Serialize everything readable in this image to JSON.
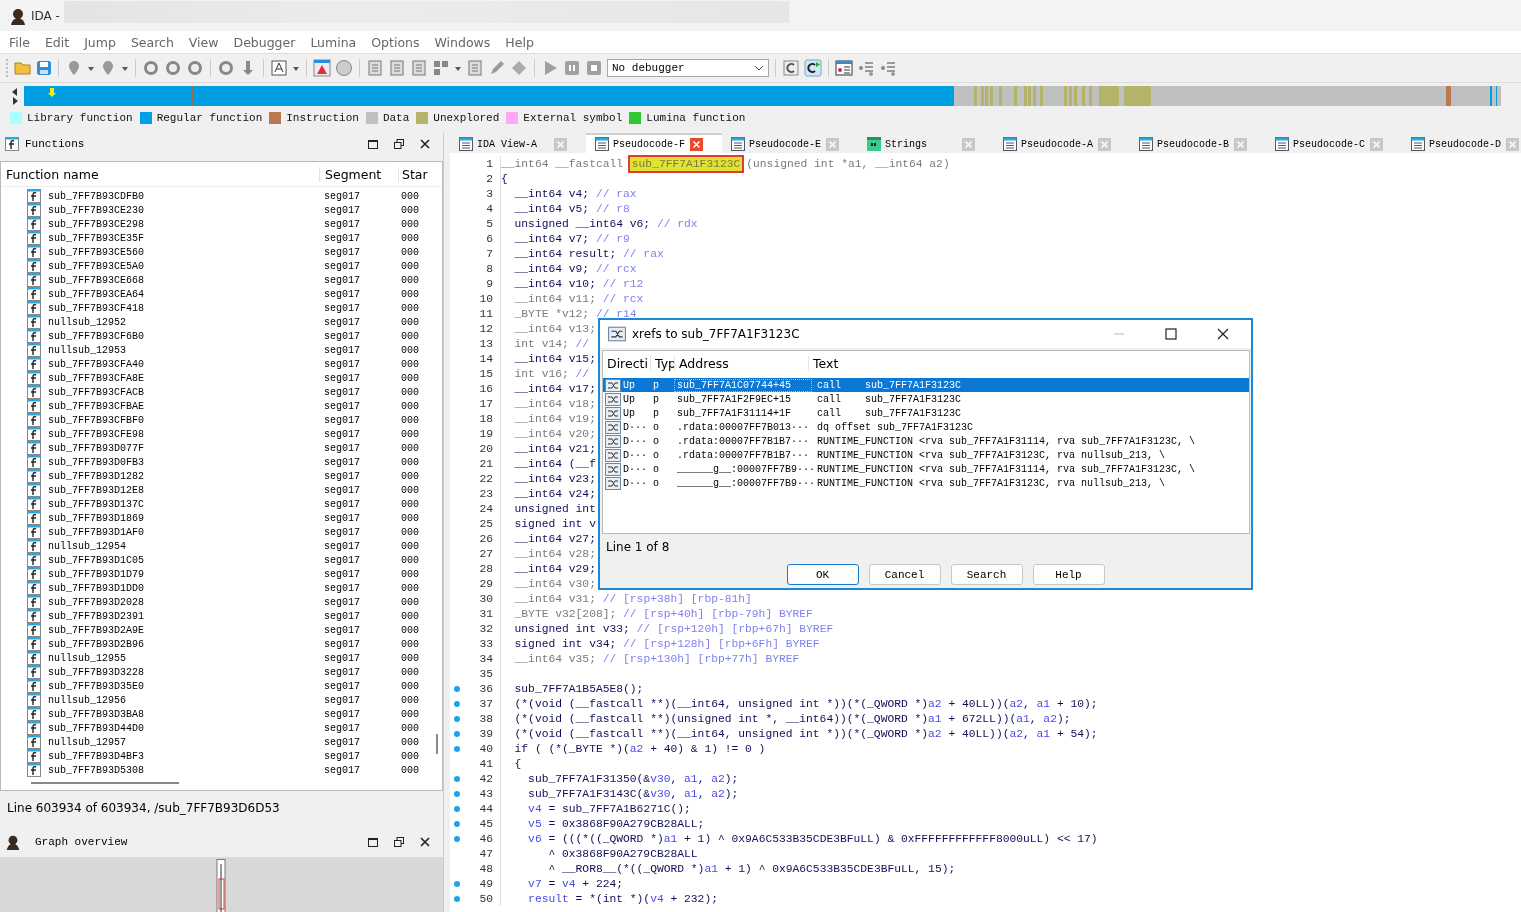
{
  "window": {
    "title": "IDA -"
  },
  "menu": [
    "File",
    "Edit",
    "Jump",
    "Search",
    "View",
    "Debugger",
    "Lumina",
    "Options",
    "Windows",
    "Help"
  ],
  "toolbar": {
    "debugger": "No debugger"
  },
  "legend": [
    {
      "label": "Library function",
      "color": "#aaffff"
    },
    {
      "label": "Regular function",
      "color": "#00a0e8"
    },
    {
      "label": "Instruction",
      "color": "#b87850"
    },
    {
      "label": "Data",
      "color": "#c0c0c0"
    },
    {
      "label": "Unexplored",
      "color": "#b4b468"
    },
    {
      "label": "External symbol",
      "color": "#ffa8f8"
    },
    {
      "label": "Lumina function",
      "color": "#30c830"
    }
  ],
  "functions_pane": {
    "title": "Functions",
    "columns": [
      "Function name",
      "Segment",
      "Star"
    ],
    "rows": [
      {
        "name": "sub_7FF7B93CDFB0",
        "segment": "seg017",
        "start": "000"
      },
      {
        "name": "sub_7FF7B93CE230",
        "segment": "seg017",
        "start": "000"
      },
      {
        "name": "sub_7FF7B93CE298",
        "segment": "seg017",
        "start": "000"
      },
      {
        "name": "sub_7FF7B93CE35F",
        "segment": "seg017",
        "start": "000"
      },
      {
        "name": "sub_7FF7B93CE560",
        "segment": "seg017",
        "start": "000"
      },
      {
        "name": "sub_7FF7B93CE5A0",
        "segment": "seg017",
        "start": "000"
      },
      {
        "name": "sub_7FF7B93CE668",
        "segment": "seg017",
        "start": "000"
      },
      {
        "name": "sub_7FF7B93CEA64",
        "segment": "seg017",
        "start": "000"
      },
      {
        "name": "sub_7FF7B93CF418",
        "segment": "seg017",
        "start": "000"
      },
      {
        "name": "nullsub_12952",
        "segment": "seg017",
        "start": "000"
      },
      {
        "name": "sub_7FF7B93CF6B0",
        "segment": "seg017",
        "start": "000"
      },
      {
        "name": "nullsub_12953",
        "segment": "seg017",
        "start": "000"
      },
      {
        "name": "sub_7FF7B93CFA40",
        "segment": "seg017",
        "start": "000"
      },
      {
        "name": "sub_7FF7B93CFA8E",
        "segment": "seg017",
        "start": "000"
      },
      {
        "name": "sub_7FF7B93CFACB",
        "segment": "seg017",
        "start": "000"
      },
      {
        "name": "sub_7FF7B93CFBAE",
        "segment": "seg017",
        "start": "000"
      },
      {
        "name": "sub_7FF7B93CFBF0",
        "segment": "seg017",
        "start": "000"
      },
      {
        "name": "sub_7FF7B93CFE98",
        "segment": "seg017",
        "start": "000"
      },
      {
        "name": "sub_7FF7B93D077F",
        "segment": "seg017",
        "start": "000"
      },
      {
        "name": "sub_7FF7B93D0FB3",
        "segment": "seg017",
        "start": "000"
      },
      {
        "name": "sub_7FF7B93D1282",
        "segment": "seg017",
        "start": "000"
      },
      {
        "name": "sub_7FF7B93D12E8",
        "segment": "seg017",
        "start": "000"
      },
      {
        "name": "sub_7FF7B93D137C",
        "segment": "seg017",
        "start": "000"
      },
      {
        "name": "sub_7FF7B93D1869",
        "segment": "seg017",
        "start": "000"
      },
      {
        "name": "sub_7FF7B93D1AF0",
        "segment": "seg017",
        "start": "000"
      },
      {
        "name": "nullsub_12954",
        "segment": "seg017",
        "start": "000"
      },
      {
        "name": "sub_7FF7B93D1C05",
        "segment": "seg017",
        "start": "000"
      },
      {
        "name": "sub_7FF7B93D1D79",
        "segment": "seg017",
        "start": "000"
      },
      {
        "name": "sub_7FF7B93D1DD0",
        "segment": "seg017",
        "start": "000"
      },
      {
        "name": "sub_7FF7B93D2028",
        "segment": "seg017",
        "start": "000"
      },
      {
        "name": "sub_7FF7B93D2391",
        "segment": "seg017",
        "start": "000"
      },
      {
        "name": "sub_7FF7B93D2A9E",
        "segment": "seg017",
        "start": "000"
      },
      {
        "name": "sub_7FF7B93D2B96",
        "segment": "seg017",
        "start": "000"
      },
      {
        "name": "nullsub_12955",
        "segment": "seg017",
        "start": "000"
      },
      {
        "name": "sub_7FF7B93D3228",
        "segment": "seg017",
        "start": "000"
      },
      {
        "name": "sub_7FF7B93D35E0",
        "segment": "seg017",
        "start": "000"
      },
      {
        "name": "nullsub_12956",
        "segment": "seg017",
        "start": "000"
      },
      {
        "name": "sub_7FF7B93D3BA8",
        "segment": "seg017",
        "start": "000"
      },
      {
        "name": "sub_7FF7B93D44D0",
        "segment": "seg017",
        "start": "000"
      },
      {
        "name": "nullsub_12957",
        "segment": "seg017",
        "start": "000"
      },
      {
        "name": "sub_7FF7B93D4BF3",
        "segment": "seg017",
        "start": "000"
      },
      {
        "name": "sub_7FF7B93D5308",
        "segment": "seg017",
        "start": "000"
      }
    ],
    "status": "Line 603934 of 603934, /sub_7FF7B93D6D53"
  },
  "graph_overview": {
    "title": "Graph overview"
  },
  "tabs": [
    {
      "label": "IDA View-A",
      "kind": "view",
      "selected": false
    },
    {
      "label": "Pseudocode-F",
      "kind": "view",
      "selected": true
    },
    {
      "label": "Pseudocode-E",
      "kind": "view",
      "selected": false
    },
    {
      "label": "Strings",
      "kind": "strings",
      "selected": false
    },
    {
      "label": "Pseudocode-A",
      "kind": "view",
      "selected": false
    },
    {
      "label": "Pseudocode-B",
      "kind": "view",
      "selected": false
    },
    {
      "label": "Pseudocode-C",
      "kind": "view",
      "selected": false
    },
    {
      "label": "Pseudocode-D",
      "kind": "view",
      "selected": false
    }
  ],
  "code": [
    {
      "n": "1",
      "bp": false,
      "parts": [
        {
          "t": "__int64 __fastcall ",
          "kind": "dim"
        },
        {
          "t": "sub_7FF7A1F3123C",
          "kind": "highlight"
        },
        {
          "t": "(unsigned int *a1, __int64 a2)",
          "kind": "dim"
        }
      ]
    },
    {
      "n": "2",
      "bp": false,
      "parts": [
        {
          "t": "{"
        }
      ]
    },
    {
      "n": "3",
      "bp": false,
      "parts": [
        {
          "t": "  __int64 v4; "
        },
        {
          "t": "// rax",
          "kind": "comment"
        }
      ]
    },
    {
      "n": "4",
      "bp": false,
      "parts": [
        {
          "t": "  __int64 v5; "
        },
        {
          "t": "// r8",
          "kind": "comment"
        }
      ]
    },
    {
      "n": "5",
      "bp": false,
      "parts": [
        {
          "t": "  unsigned __int64 v6; "
        },
        {
          "t": "// rdx",
          "kind": "comment"
        }
      ]
    },
    {
      "n": "6",
      "bp": false,
      "parts": [
        {
          "t": "  __int64 v7; "
        },
        {
          "t": "// r9",
          "kind": "comment"
        }
      ]
    },
    {
      "n": "7",
      "bp": false,
      "parts": [
        {
          "t": "  __int64 result; "
        },
        {
          "t": "// rax",
          "kind": "comment"
        }
      ]
    },
    {
      "n": "8",
      "bp": false,
      "parts": [
        {
          "t": "  __int64 v9; "
        },
        {
          "t": "// rcx",
          "kind": "comment"
        }
      ]
    },
    {
      "n": "9",
      "bp": false,
      "parts": [
        {
          "t": "  __int64 v10; "
        },
        {
          "t": "// r12",
          "kind": "comment"
        }
      ]
    },
    {
      "n": "10",
      "bp": false,
      "parts": [
        {
          "t": "  __int64 v11; ",
          "kind": "dim"
        },
        {
          "t": "// rcx",
          "kind": "comment"
        }
      ]
    },
    {
      "n": "11",
      "bp": false,
      "parts": [
        {
          "t": "  _BYTE *v12; ",
          "kind": "dim"
        },
        {
          "t": "// r14",
          "kind": "comment"
        }
      ]
    },
    {
      "n": "12",
      "bp": false,
      "parts": [
        {
          "t": "  __int64 v13;",
          "kind": "dim"
        }
      ]
    },
    {
      "n": "13",
      "bp": false,
      "parts": [
        {
          "t": "  int v14; ",
          "kind": "dim"
        },
        {
          "t": "//",
          "kind": "comment"
        }
      ]
    },
    {
      "n": "14",
      "bp": false,
      "parts": [
        {
          "t": "  __int64 v15;"
        }
      ]
    },
    {
      "n": "15",
      "bp": false,
      "parts": [
        {
          "t": "  int v16; ",
          "kind": "dim"
        },
        {
          "t": "//",
          "kind": "comment"
        }
      ]
    },
    {
      "n": "16",
      "bp": false,
      "parts": [
        {
          "t": "  __int64 v17;"
        }
      ]
    },
    {
      "n": "17",
      "bp": false,
      "parts": [
        {
          "t": "  __int64 v18;",
          "kind": "dim"
        }
      ]
    },
    {
      "n": "18",
      "bp": false,
      "parts": [
        {
          "t": "  __int64 v19;",
          "kind": "dim"
        }
      ]
    },
    {
      "n": "19",
      "bp": false,
      "parts": [
        {
          "t": "  __int64 v20;",
          "kind": "dim"
        }
      ]
    },
    {
      "n": "20",
      "bp": false,
      "parts": [
        {
          "t": "  __int64 v21;"
        }
      ]
    },
    {
      "n": "21",
      "bp": false,
      "parts": [
        {
          "t": "  __int64 (__f"
        }
      ]
    },
    {
      "n": "22",
      "bp": false,
      "parts": [
        {
          "t": "  __int64 v23;"
        }
      ]
    },
    {
      "n": "23",
      "bp": false,
      "parts": [
        {
          "t": "  __int64 v24;"
        }
      ]
    },
    {
      "n": "24",
      "bp": false,
      "parts": [
        {
          "t": "  unsigned int"
        }
      ]
    },
    {
      "n": "25",
      "bp": false,
      "parts": [
        {
          "t": "  signed int v"
        }
      ]
    },
    {
      "n": "26",
      "bp": false,
      "parts": [
        {
          "t": "  __int64 v27;"
        }
      ]
    },
    {
      "n": "27",
      "bp": false,
      "parts": [
        {
          "t": "  __int64 v28;",
          "kind": "dim"
        }
      ]
    },
    {
      "n": "28",
      "bp": false,
      "parts": [
        {
          "t": "  __int64 v29;"
        }
      ]
    },
    {
      "n": "29",
      "bp": false,
      "parts": [
        {
          "t": "  __int64 v30;",
          "kind": "dim"
        }
      ]
    },
    {
      "n": "30",
      "bp": false,
      "parts": [
        {
          "t": "  __int64 v31; ",
          "kind": "dim"
        },
        {
          "t": "// [rsp+38h] [rbp-81h]",
          "kind": "comment"
        }
      ]
    },
    {
      "n": "31",
      "bp": false,
      "parts": [
        {
          "t": "  _BYTE v32[208]; ",
          "kind": "dim"
        },
        {
          "t": "// [rsp+40h] [rbp-79h] BYREF",
          "kind": "comment"
        }
      ]
    },
    {
      "n": "32",
      "bp": false,
      "parts": [
        {
          "t": "  unsigned int v33; "
        },
        {
          "t": "// [rsp+120h] [rbp+67h] BYREF",
          "kind": "comment"
        }
      ]
    },
    {
      "n": "33",
      "bp": false,
      "parts": [
        {
          "t": "  signed int v34; "
        },
        {
          "t": "// [rsp+128h] [rbp+6Fh] BYREF",
          "kind": "comment"
        }
      ]
    },
    {
      "n": "34",
      "bp": false,
      "parts": [
        {
          "t": "  __int64 v35; ",
          "kind": "dim"
        },
        {
          "t": "// [rsp+130h] [rbp+77h] BYREF",
          "kind": "comment"
        }
      ]
    },
    {
      "n": "35",
      "bp": false
    },
    {
      "n": "36",
      "bp": true,
      "parts": [
        {
          "t": "  sub_7FF7A1B5A5E8();"
        }
      ]
    },
    {
      "n": "37",
      "bp": true,
      "parts": [
        {
          "t": "  (*(void (__fastcall **)(__int64, unsigned int *))(*(_QWORD *)"
        },
        {
          "t": "a2",
          "kind": "var"
        },
        {
          "t": " + 40LL))("
        },
        {
          "t": "a2",
          "kind": "var"
        },
        {
          "t": ", "
        },
        {
          "t": "a1",
          "kind": "var"
        },
        {
          "t": " + 10);"
        }
      ]
    },
    {
      "n": "38",
      "bp": true,
      "parts": [
        {
          "t": "  (*(void (__fastcall **)(unsigned int *, __int64))(*(_QWORD *)"
        },
        {
          "t": "a1",
          "kind": "var"
        },
        {
          "t": " + 672LL))("
        },
        {
          "t": "a1",
          "kind": "var"
        },
        {
          "t": ", "
        },
        {
          "t": "a2",
          "kind": "var"
        },
        {
          "t": ");"
        }
      ]
    },
    {
      "n": "39",
      "bp": true,
      "parts": [
        {
          "t": "  (*(void (__fastcall **)(__int64, unsigned int *))(*(_QWORD *)"
        },
        {
          "t": "a2",
          "kind": "var"
        },
        {
          "t": " + 40LL))("
        },
        {
          "t": "a2",
          "kind": "var"
        },
        {
          "t": ", "
        },
        {
          "t": "a1",
          "kind": "var"
        },
        {
          "t": " + 54);"
        }
      ]
    },
    {
      "n": "40",
      "bp": true,
      "parts": [
        {
          "t": "  if ( (*(_BYTE *)("
        },
        {
          "t": "a2",
          "kind": "var"
        },
        {
          "t": " + 40) & 1) != 0 )"
        }
      ]
    },
    {
      "n": "41",
      "bp": false,
      "parts": [
        {
          "t": "  {"
        }
      ]
    },
    {
      "n": "42",
      "bp": true,
      "parts": [
        {
          "t": "    sub_7FF7A1F31350(&"
        },
        {
          "t": "v30",
          "kind": "var"
        },
        {
          "t": ", "
        },
        {
          "t": "a1",
          "kind": "var"
        },
        {
          "t": ", "
        },
        {
          "t": "a2",
          "kind": "var"
        },
        {
          "t": ");"
        }
      ]
    },
    {
      "n": "43",
      "bp": true,
      "parts": [
        {
          "t": "    sub_7FF7A1F3143C(&"
        },
        {
          "t": "v30",
          "kind": "var"
        },
        {
          "t": ", "
        },
        {
          "t": "a1",
          "kind": "var"
        },
        {
          "t": ", "
        },
        {
          "t": "a2",
          "kind": "var"
        },
        {
          "t": ");"
        }
      ]
    },
    {
      "n": "44",
      "bp": true,
      "parts": [
        {
          "t": "    v4",
          "kind": "var"
        },
        {
          "t": " = sub_7FF7A1B6271C();"
        }
      ]
    },
    {
      "n": "45",
      "bp": true,
      "parts": [
        {
          "t": "    v5",
          "kind": "var"
        },
        {
          "t": " = 0x3868F90A279CB28ALL;"
        }
      ]
    },
    {
      "n": "46",
      "bp": true,
      "parts": [
        {
          "t": "    v6",
          "kind": "var"
        },
        {
          "t": " = (((*((_QWORD *)"
        },
        {
          "t": "a1",
          "kind": "var"
        },
        {
          "t": " + 1) ^ 0x9A6C533B35CDE3BFuLL) & 0xFFFFFFFFFFFF8000uLL) << 17)"
        }
      ]
    },
    {
      "n": "47",
      "bp": false,
      "parts": [
        {
          "t": "       ^ 0x3868F90A279CB28ALL"
        }
      ]
    },
    {
      "n": "48",
      "bp": false,
      "parts": [
        {
          "t": "       ^ __ROR8__(*((_QWORD *)"
        },
        {
          "t": "a1",
          "kind": "var"
        },
        {
          "t": " + 1) ^ 0x9A6C533B35CDE3BFuLL, 15);"
        }
      ]
    },
    {
      "n": "49",
      "bp": true,
      "parts": [
        {
          "t": "    v7",
          "kind": "var"
        },
        {
          "t": " = "
        },
        {
          "t": "v4",
          "kind": "var"
        },
        {
          "t": " + 224;"
        }
      ]
    },
    {
      "n": "50",
      "bp": true,
      "parts": [
        {
          "t": "    result",
          "kind": "var"
        },
        {
          "t": " = *(int *)("
        },
        {
          "t": "v4",
          "kind": "var"
        },
        {
          "t": " + 232);"
        }
      ]
    }
  ],
  "dialog": {
    "title": "xrefs to sub_7FF7A1F3123C",
    "columns": [
      "Directi",
      "Typ",
      "Address",
      "Text"
    ],
    "rows": [
      {
        "direction": "Up",
        "type": "p",
        "address": "sub_7FF7A1C07744+45",
        "text": "call    sub_7FF7A1F3123C",
        "selected": true
      },
      {
        "direction": "Up",
        "type": "p",
        "address": "sub_7FF7A1F2F9EC+15",
        "text": "call    sub_7FF7A1F3123C",
        "selected": false
      },
      {
        "direction": "Up",
        "type": "p",
        "address": "sub_7FF7A1F31114+1F",
        "text": "call    sub_7FF7A1F3123C",
        "selected": false
      },
      {
        "direction": "D···",
        "type": "o",
        "address": ".rdata:00007FF7B013···",
        "text": "dq offset sub_7FF7A1F3123C",
        "selected": false
      },
      {
        "direction": "D···",
        "type": "o",
        "address": ".rdata:00007FF7B1B7···",
        "text": "RUNTIME_FUNCTION <rva sub_7FF7A1F31114, rva sub_7FF7A1F3123C, \\",
        "selected": false
      },
      {
        "direction": "D···",
        "type": "o",
        "address": ".rdata:00007FF7B1B7···",
        "text": "RUNTIME_FUNCTION <rva sub_7FF7A1F3123C, rva nullsub_213, \\",
        "selected": false
      },
      {
        "direction": "D···",
        "type": "o",
        "address": "______g__:00007FF7B9···",
        "text": "RUNTIME_FUNCTION <rva sub_7FF7A1F31114, rva sub_7FF7A1F3123C, \\",
        "selected": false
      },
      {
        "direction": "D···",
        "type": "o",
        "address": "______g__:00007FF7B9···",
        "text": "RUNTIME_FUNCTION <rva sub_7FF7A1F3123C, rva nullsub_213, \\",
        "selected": false
      }
    ],
    "status": "Line 1 of 8",
    "buttons": [
      {
        "label": "OK",
        "default": true
      },
      {
        "label": "Cancel",
        "default": false
      },
      {
        "label": "Search",
        "default": false
      },
      {
        "label": "Help",
        "default": false
      }
    ]
  }
}
